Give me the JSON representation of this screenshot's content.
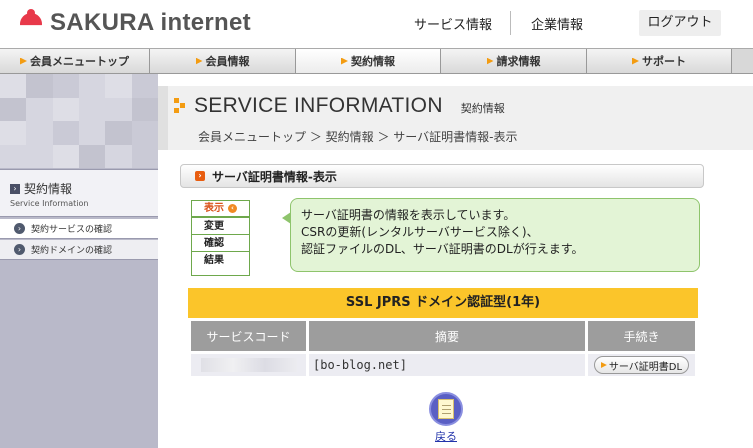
{
  "header": {
    "logo_text": "SAKURA internet",
    "links": [
      "サービス情報",
      "企業情報"
    ],
    "logout_label": "ログアウト"
  },
  "nav": {
    "items": [
      {
        "label": "会員メニュートップ",
        "active": false
      },
      {
        "label": "会員情報",
        "active": false
      },
      {
        "label": "契約情報",
        "active": true
      },
      {
        "label": "請求情報",
        "active": false
      },
      {
        "label": "サポート",
        "active": false
      }
    ]
  },
  "sidebar": {
    "title": "契約情報",
    "subtitle": "Service Information",
    "items": [
      {
        "label": "契約サービスの確認",
        "active": true
      },
      {
        "label": "契約ドメインの確認",
        "active": false
      }
    ]
  },
  "main": {
    "title_en": "SERVICE INFORMATION",
    "title_jp": "契約情報",
    "breadcrumb": "会員メニュートップ ＞ 契約情報 ＞ サーバ証明書情報-表示",
    "section_title": "サーバ証明書情報-表示",
    "steps": [
      {
        "label": "表示",
        "current": true
      },
      {
        "label": "変更",
        "current": false
      },
      {
        "label": "確認",
        "current": false
      },
      {
        "label": "結果",
        "current": false
      }
    ],
    "info_lines": [
      "サーバ証明書の情報を表示しています。",
      "CSRの更新(レンタルサーバサービス除く)、",
      "認証ファイルのDL、サーバ証明書のDLが行えます。"
    ],
    "table": {
      "caption": "SSL JPRS ドメイン認証型(1年)",
      "headers": [
        "サービスコード",
        "摘要",
        "手続き"
      ],
      "row": {
        "summary": "[bo-blog.net]",
        "action_label": "サーバ証明書DL"
      }
    },
    "back_label": "戻る"
  },
  "colors": {
    "brand_red": "#e8394a",
    "accent_orange": "#f39c12",
    "caption_yellow": "#fbc52a",
    "info_green": "#e3f4d6",
    "sidebar_bg": "#b9b9c9"
  },
  "icons": [
    "sakura-logo-icon",
    "nav-bullet-icon",
    "arrow-square-icon",
    "circle-arrow-icon",
    "orange-square-icon",
    "step-current-icon",
    "download-bullet-icon",
    "back-document-icon"
  ]
}
